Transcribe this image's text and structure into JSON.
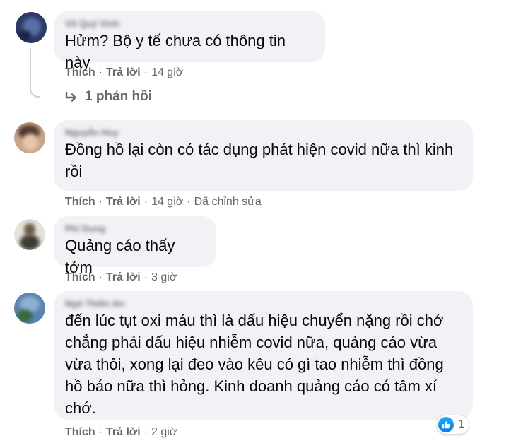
{
  "comments": [
    {
      "author": "Võ Quý Vinh",
      "text": "Hửm? Bộ y tế chưa có thông tin này",
      "like_label": "Thích",
      "reply_label": "Trả lời",
      "time": "14 giờ",
      "replies_label": "1 phản hồi"
    },
    {
      "author": "Nguyễn Huy",
      "text": "Đồng hồ lại còn có tác dụng phát hiện covid nữa thì kinh\nrồi",
      "like_label": "Thích",
      "reply_label": "Trả lời",
      "time": "14 giờ",
      "edited": "Đã chỉnh sửa"
    },
    {
      "author": "Phi Dung",
      "text": "Quảng cáo thấy tởm",
      "like_label": "Thích",
      "reply_label": "Trả lời",
      "time": "3 giờ"
    },
    {
      "author": "Ngô Thiên An",
      "text": "đến lúc tụt oxi máu thì là dấu hiệu chuyển nặng rồi chớ\nchẳng phải dấu hiệu nhiễm covid nữa, quảng cáo vừa\nvừa thôi, xong lại đeo vào kêu có gì tao nhiễm thì đồng\nhồ báo nữa thì hỏng. Kinh doanh quảng cáo có tâm xí\nchớ.",
      "like_label": "Thích",
      "reply_label": "Trả lời",
      "time": "2 giờ",
      "reaction_icon": "like-icon",
      "reaction_count": "1"
    }
  ],
  "colors": {
    "bubble": "#f0f2f5",
    "meta_text": "#65676b",
    "like_blue": "#1877f2"
  }
}
